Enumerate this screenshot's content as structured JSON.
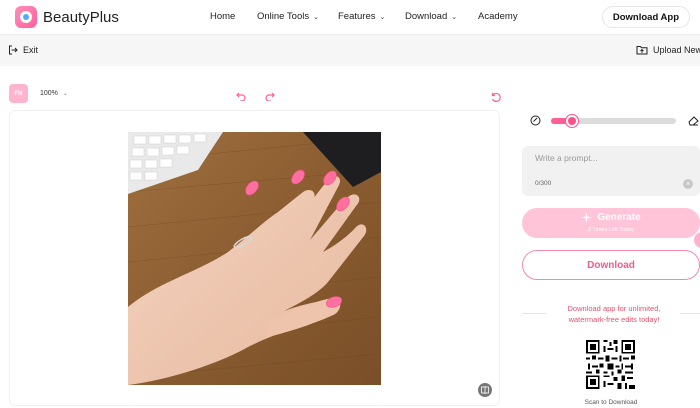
{
  "nav": {
    "brand": "BeautyPlus",
    "items": [
      {
        "label": "Home",
        "has_dropdown": false
      },
      {
        "label": "Online Tools",
        "has_dropdown": true
      },
      {
        "label": "Features",
        "has_dropdown": true
      },
      {
        "label": "Download",
        "has_dropdown": true
      },
      {
        "label": "Academy",
        "has_dropdown": false
      }
    ],
    "cta": "Download App"
  },
  "subbar": {
    "exit": "Exit",
    "upload": "Upload New"
  },
  "editor": {
    "badge": "FN",
    "zoom": "100%",
    "icons": [
      "undo-icon",
      "redo-icon",
      "reset-icon",
      "compare-icon"
    ]
  },
  "panel": {
    "brush_size": 0.17,
    "prompt_placeholder": "Write a prompt...",
    "prompt_count": "0/300",
    "generate_label": "Generate",
    "generate_sub": "2 Times Left Today",
    "download_label": "Download",
    "promo_line1": "Download app for unlimited,",
    "promo_line2": "watermark-free edits today!",
    "scan_label": "Scan to Download"
  },
  "colors": {
    "accent": "#ff5f92",
    "generate_bg": "#ffc4d8",
    "promo_text": "#e2536f"
  }
}
